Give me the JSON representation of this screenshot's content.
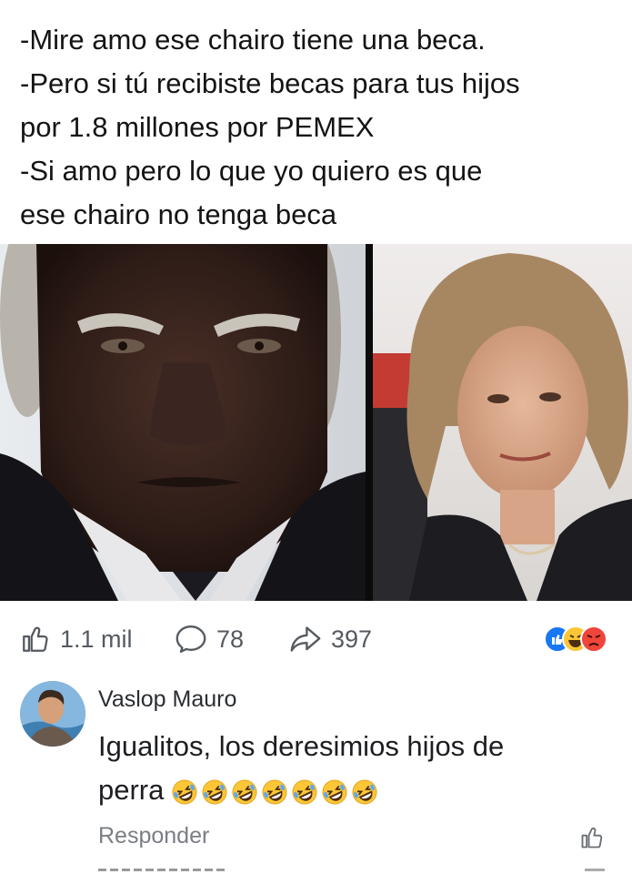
{
  "post": {
    "lines": [
      "-Mire amo ese chairo tiene una beca.",
      "-Pero si tú recibiste becas para tus hijos",
      "por  1.8 millones por PEMEX",
      "-Si amo pero lo que yo quiero es que",
      "ese chairo no tenga beca"
    ]
  },
  "actions": {
    "likes": "1.1 mil",
    "comments": "78",
    "shares": "397"
  },
  "reactions": [
    "like-icon",
    "laugh-icon",
    "angry-icon"
  ],
  "comment": {
    "author": "Vaslop Mauro",
    "line1": "Igualitos, los deresimios hijos de",
    "line2": "perra",
    "emoji_count": 7,
    "reply_label": "Responder"
  },
  "colors": {
    "like_blue": "#1877f2",
    "angry_red": "#f0453a",
    "laugh_yellow": "#fcc636",
    "secondary_text": "#7a7f85"
  }
}
